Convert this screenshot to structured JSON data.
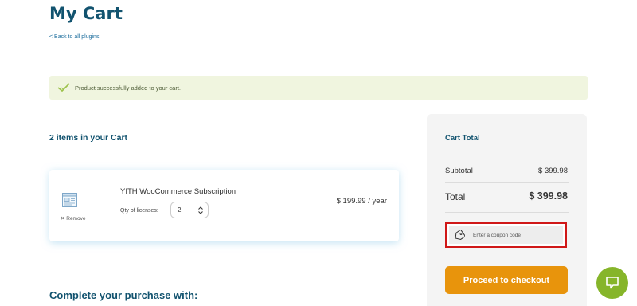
{
  "header": {
    "title": "My Cart",
    "back_link": "< Back to all plugins"
  },
  "notice": {
    "message": "Product successfully added to your cart.",
    "icon": "checkmark-icon",
    "color": "#f0f5df"
  },
  "cart": {
    "items_heading": "2 items in your Cart",
    "items": [
      {
        "name": "YITH WooCommerce Subscription",
        "qty_label": "Qty of licenses:",
        "qty_value": "2",
        "price": "$ 199.99 / year",
        "remove_label": "✕ Remove",
        "icon": "plugin-thumbnail-icon"
      }
    ]
  },
  "summary": {
    "title": "Cart Total",
    "subtotal_label": "Subtotal",
    "subtotal_value": "$ 399.98",
    "total_label": "Total",
    "total_value": "$ 399.98",
    "coupon_placeholder": "Enter a coupon code",
    "checkout_label": "Proceed to checkout"
  },
  "upsell": {
    "heading": "Complete your purchase with:"
  },
  "chat": {
    "icon": "chat-icon"
  },
  "colors": {
    "heading": "#12536f",
    "accent": "#e8940c",
    "chat": "#86b52a",
    "highlight_border": "#d01818"
  }
}
